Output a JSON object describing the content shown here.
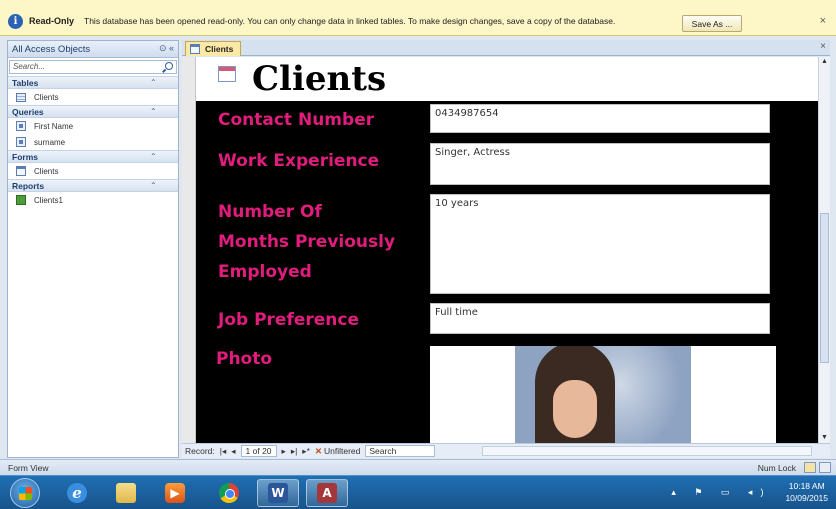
{
  "message_bar": {
    "title": "Read-Only",
    "text": "This database has been opened read-only. You can only change data in linked tables. To make design changes, save a copy of the database.",
    "save_as_label": "Save As ...",
    "close_glyph": "×"
  },
  "nav_pane": {
    "title": "All Access Objects",
    "search_placeholder": "Search...",
    "groups": [
      {
        "label": "Tables",
        "items": [
          {
            "label": "Clients",
            "icon": "table-icon"
          }
        ]
      },
      {
        "label": "Queries",
        "items": [
          {
            "label": "First Name",
            "icon": "query-icon"
          },
          {
            "label": "surname",
            "icon": "query-icon"
          }
        ]
      },
      {
        "label": "Forms",
        "items": [
          {
            "label": "Clients",
            "icon": "form-icon"
          }
        ]
      },
      {
        "label": "Reports",
        "items": [
          {
            "label": "Clients1",
            "icon": "report-icon"
          }
        ]
      }
    ]
  },
  "document": {
    "tab_label": "Clients",
    "form_title": "Clients",
    "fields": {
      "contact_number": {
        "label": "Contact Number",
        "value": "0434987654"
      },
      "work_experience": {
        "label": "Work Experience",
        "value": "Singer, Actress"
      },
      "months_employed": {
        "label_line1": "Number Of",
        "label_line2": "Months Previously",
        "label_line3": "Employed",
        "value": "10 years"
      },
      "job_preference": {
        "label": "Job Preference",
        "value": "Full time"
      },
      "photo": {
        "label": "Photo"
      }
    }
  },
  "record_nav": {
    "prefix": "Record:",
    "current": "1 of 20",
    "filter_label": "Unfiltered",
    "search_label": "Search"
  },
  "status_bar": {
    "left": "Form View",
    "right": "Num Lock"
  },
  "taskbar": {
    "apps": [
      "internet-explorer",
      "windows-explorer",
      "media-player",
      "chrome",
      "word",
      "access"
    ],
    "clock_time": "10:18 AM",
    "clock_date": "10/09/2015"
  },
  "colors": {
    "label_pink": "#e01c7c",
    "detail_bg": "#000000",
    "message_bar_bg": "#fdf6c6"
  }
}
